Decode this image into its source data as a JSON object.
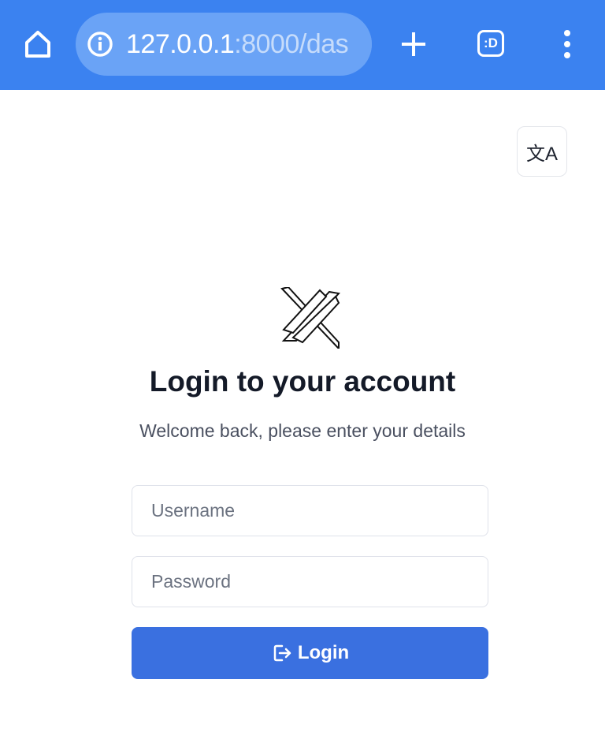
{
  "browser": {
    "url_host": "127.0.0.1",
    "url_rest": ":8000/das",
    "tab_count_label": ":D",
    "icons": {
      "home": "home-icon",
      "info": "info-icon",
      "new_tab": "plus-icon",
      "menu": "more-vert-icon"
    },
    "bar_color": "#3b82f0"
  },
  "translate": {
    "icon": "translate-icon",
    "glyph": "文A"
  },
  "login": {
    "title": "Login to your account",
    "subtitle": "Welcome back, please enter your details",
    "username_placeholder": "Username",
    "password_placeholder": "Password",
    "button_label": "Login",
    "button_icon": "login-icon",
    "button_color": "#3a70e0"
  }
}
